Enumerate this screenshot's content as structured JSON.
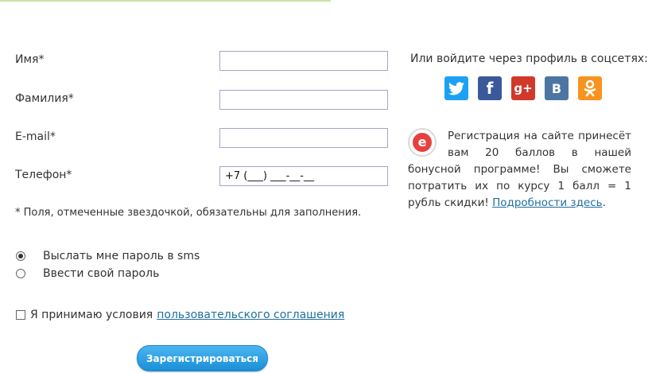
{
  "form": {
    "fields": [
      {
        "label": "Имя*",
        "value": "",
        "placeholder": ""
      },
      {
        "label": "Фамилия*",
        "value": "",
        "placeholder": ""
      },
      {
        "label": "E-mail*",
        "value": "",
        "placeholder": ""
      },
      {
        "label": "Телефон*",
        "value": "+7 (___) ___-__-__",
        "placeholder": ""
      }
    ],
    "required_note": "* Поля, отмеченные звездочкой, обязательны для заполнения.",
    "password_options": [
      {
        "label": "Выслать мне пароль в sms",
        "checked": true
      },
      {
        "label": "Ввести свой пароль",
        "checked": false
      }
    ],
    "agree_text": "Я принимаю условия",
    "agree_link": "пользовательского соглашения",
    "agree_checked": false,
    "submit_label": "Зарегистрироваться"
  },
  "social": {
    "title": "Или войдите через профиль в соцсетях:",
    "networks": [
      {
        "name": "twitter",
        "icon": "twitter-icon",
        "color": "#1da1f2"
      },
      {
        "name": "facebook",
        "icon": "facebook-icon",
        "glyph": "f",
        "color": "#3b5998"
      },
      {
        "name": "google-plus",
        "icon": "google-plus-icon",
        "glyph": "g+",
        "color": "#d1392b"
      },
      {
        "name": "vkontakte",
        "icon": "vk-icon",
        "glyph": "В",
        "color": "#4c75a3"
      },
      {
        "name": "odnoklassniki",
        "icon": "odnoklassniki-icon",
        "color": "#f7931e"
      }
    ]
  },
  "bonus": {
    "icon": "bonus-e-icon",
    "icon_glyph": "e",
    "text": "Регистрация на сайте принесёт вам 20 баллов в нашей бонусной программе! Вы сможете потратить их по курсу 1 балл = 1 рубль скидки! ",
    "link": "Подробности здесь",
    "after_link": "."
  }
}
